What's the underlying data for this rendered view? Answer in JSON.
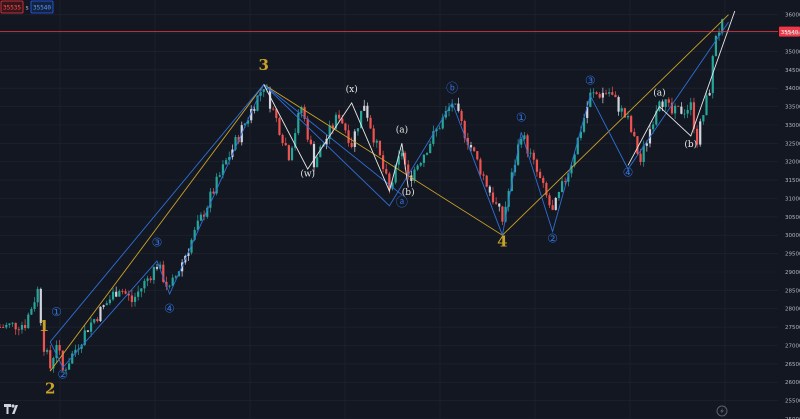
{
  "toolbar": {
    "sell_price": "35535",
    "separator": "s",
    "buy_price": "35540"
  },
  "watermark_icon": "tradingview-logo-icon",
  "replay_icon": "lightning-icon",
  "colors": {
    "background": "#131722",
    "candle_up": "#26a69a",
    "candle_down": "#ef5350",
    "candle_neutral": "#d1d4dc",
    "primary_wave": "#c9a227",
    "blue_wave": "#2f6fd6",
    "white_wave": "#e8e8e8",
    "price_line": "#f23645"
  },
  "chart_data": {
    "type": "candlestick",
    "title": "",
    "xlabel": "",
    "ylabel": "",
    "ylim": [
      25000,
      36400
    ],
    "current_price": 35540,
    "current_price_label": "35540",
    "y_ticks": [
      25000,
      25500,
      26000,
      26500,
      27000,
      27500,
      28000,
      28500,
      29000,
      29500,
      30000,
      30500,
      31000,
      31500,
      32000,
      32500,
      33000,
      33500,
      34000,
      34500,
      35000,
      35500,
      36000
    ],
    "y_tick_labels": [
      "25000",
      "25500",
      "26000",
      "26500",
      "27000",
      "27500",
      "28000",
      "28500",
      "29000",
      "29500",
      "30000",
      "30500",
      "31000",
      "31500",
      "32000",
      "32500",
      "33000",
      "33500",
      "34000",
      "34500",
      "35000",
      "35500",
      "36000"
    ],
    "price_path": [
      {
        "t": 0,
        "p": 27500
      },
      {
        "t": 4,
        "p": 27600
      },
      {
        "t": 6,
        "p": 28500
      },
      {
        "t": 7,
        "p": 27000
      },
      {
        "t": 8,
        "p": 26400
      },
      {
        "t": 9,
        "p": 27100
      },
      {
        "t": 10,
        "p": 26300
      },
      {
        "t": 14,
        "p": 27500
      },
      {
        "t": 19,
        "p": 28600
      },
      {
        "t": 21,
        "p": 28200
      },
      {
        "t": 25,
        "p": 29200
      },
      {
        "t": 27,
        "p": 28500
      },
      {
        "t": 36,
        "p": 32000
      },
      {
        "t": 42,
        "p": 34100
      },
      {
        "t": 46,
        "p": 32200
      },
      {
        "t": 48,
        "p": 33500
      },
      {
        "t": 50,
        "p": 32000
      },
      {
        "t": 54,
        "p": 33300
      },
      {
        "t": 56,
        "p": 32500
      },
      {
        "t": 58,
        "p": 33600
      },
      {
        "t": 62,
        "p": 31200
      },
      {
        "t": 64,
        "p": 32300
      },
      {
        "t": 65,
        "p": 31500
      },
      {
        "t": 72,
        "p": 33600
      },
      {
        "t": 80,
        "p": 30400
      },
      {
        "t": 83,
        "p": 32800
      },
      {
        "t": 88,
        "p": 30600
      },
      {
        "t": 91,
        "p": 32000
      },
      {
        "t": 94,
        "p": 33800
      },
      {
        "t": 97,
        "p": 33900
      },
      {
        "t": 100,
        "p": 33100
      },
      {
        "t": 102,
        "p": 32000
      },
      {
        "t": 105,
        "p": 33800
      },
      {
        "t": 107,
        "p": 33300
      },
      {
        "t": 110,
        "p": 33500
      },
      {
        "t": 111,
        "p": 32600
      },
      {
        "t": 113,
        "p": 34000
      },
      {
        "t": 114,
        "p": 35500
      },
      {
        "t": 115,
        "p": 35700
      }
    ],
    "wave_lines": [
      {
        "style": "primary",
        "points": [
          [
            8,
            26300
          ],
          [
            42,
            34100
          ],
          [
            80,
            30000
          ],
          [
            116,
            36000
          ]
        ]
      },
      {
        "style": "blue",
        "points": [
          [
            8,
            27100
          ],
          [
            10,
            26400
          ],
          [
            25,
            29300
          ],
          [
            27,
            28400
          ],
          [
            42,
            34100
          ],
          [
            62,
            30800
          ],
          [
            72,
            33600
          ],
          [
            80,
            30000
          ],
          [
            83,
            32800
          ],
          [
            88,
            30100
          ],
          [
            94,
            33800
          ],
          [
            100,
            31800
          ],
          [
            116,
            35800
          ]
        ]
      },
      {
        "style": "blue",
        "points": [
          [
            8,
            27100
          ],
          [
            42,
            34100
          ],
          [
            64,
            31100
          ]
        ]
      },
      {
        "style": "white",
        "points": [
          [
            42,
            34100
          ],
          [
            49,
            31800
          ],
          [
            56,
            33600
          ],
          [
            62,
            31200
          ],
          [
            64,
            32500
          ],
          [
            65,
            31300
          ]
        ]
      },
      {
        "style": "white",
        "points": [
          [
            100,
            31900
          ],
          [
            105,
            33500
          ],
          [
            110,
            32700
          ],
          [
            117,
            36100
          ]
        ]
      }
    ],
    "wave_labels": [
      {
        "text": "1",
        "style": "primary",
        "t": 7,
        "p": 27400
      },
      {
        "text": "2",
        "style": "primary",
        "t": 8,
        "p": 25700
      },
      {
        "text": "3",
        "style": "primary",
        "t": 42,
        "p": 34500
      },
      {
        "text": "4",
        "style": "primary",
        "t": 80,
        "p": 29700
      },
      {
        "text": "①",
        "style": "blue",
        "t": 9,
        "p": 27800
      },
      {
        "text": "②",
        "style": "blue",
        "t": 10,
        "p": 26100
      },
      {
        "text": "③",
        "style": "blue",
        "t": 25,
        "p": 29700
      },
      {
        "text": "④",
        "style": "blue",
        "t": 27,
        "p": 27900
      },
      {
        "text": "ⓐ",
        "style": "blue",
        "t": 64,
        "p": 30800
      },
      {
        "text": "ⓑ",
        "style": "blue",
        "t": 72,
        "p": 33900
      },
      {
        "text": "①",
        "style": "blue",
        "t": 83,
        "p": 33100
      },
      {
        "text": "②",
        "style": "blue",
        "t": 88,
        "p": 29800
      },
      {
        "text": "③",
        "style": "blue",
        "t": 94,
        "p": 34100
      },
      {
        "text": "④",
        "style": "blue",
        "t": 100,
        "p": 31600
      },
      {
        "text": "(w)",
        "style": "white",
        "t": 49,
        "p": 31600
      },
      {
        "text": "(x)",
        "style": "white",
        "t": 56,
        "p": 33900
      },
      {
        "text": "(a)",
        "style": "white",
        "t": 64,
        "p": 32800
      },
      {
        "text": "(b)",
        "style": "white",
        "t": 65,
        "p": 31100
      },
      {
        "text": "(a)",
        "style": "white",
        "t": 105,
        "p": 33800
      },
      {
        "text": "(b)",
        "style": "white",
        "t": 110,
        "p": 32400
      }
    ]
  }
}
